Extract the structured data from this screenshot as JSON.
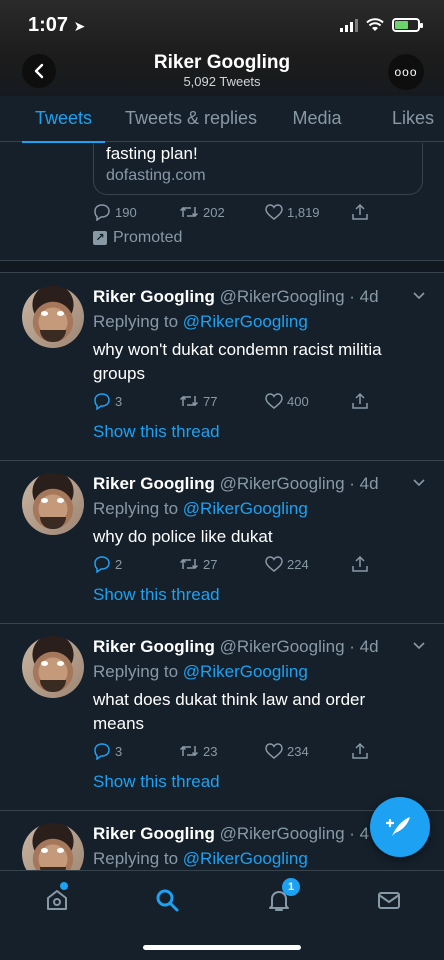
{
  "status_bar": {
    "time": "1:07"
  },
  "header": {
    "title": "Riker Googling",
    "subtitle": "5,092 Tweets",
    "more_label": "ooo"
  },
  "tabs": [
    {
      "label": "Tweets",
      "active": true
    },
    {
      "label": "Tweets & replies",
      "active": false
    },
    {
      "label": "Media",
      "active": false
    },
    {
      "label": "Likes",
      "active": false
    }
  ],
  "promo": {
    "card_title": "fasting plan!",
    "card_domain": "dofasting.com",
    "replies": "190",
    "retweets": "202",
    "likes": "1,819",
    "promoted_label": "Promoted"
  },
  "tweets": [
    {
      "name": "Riker Googling",
      "meta": "@RikerGoogling · 4d",
      "replying_prefix": "Replying to",
      "replying_handle": "@RikerGoogling",
      "text": "why won't dukat condemn racist militia groups",
      "replies": "3",
      "retweets": "77",
      "likes": "400",
      "thread_label": "Show this thread"
    },
    {
      "name": "Riker Googling",
      "meta": "@RikerGoogling · 4d",
      "replying_prefix": "Replying to",
      "replying_handle": "@RikerGoogling",
      "text": "why do police like dukat",
      "replies": "2",
      "retweets": "27",
      "likes": "224",
      "thread_label": "Show this thread"
    },
    {
      "name": "Riker Googling",
      "meta": "@RikerGoogling · 4d",
      "replying_prefix": "Replying to",
      "replying_handle": "@RikerGoogling",
      "text": "what does dukat think law and order means",
      "replies": "3",
      "retweets": "23",
      "likes": "234",
      "thread_label": "Show this thread"
    },
    {
      "name": "Riker Googling",
      "meta": "@RikerGoogling · 4",
      "replying_prefix": "Replying to",
      "replying_handle": "@RikerGoogling"
    }
  ],
  "bottom_nav": {
    "notifications_badge": "1"
  },
  "colors": {
    "background": "#15202b",
    "accent": "#1da1f2",
    "muted": "#8899a6",
    "divider": "#38444d"
  }
}
